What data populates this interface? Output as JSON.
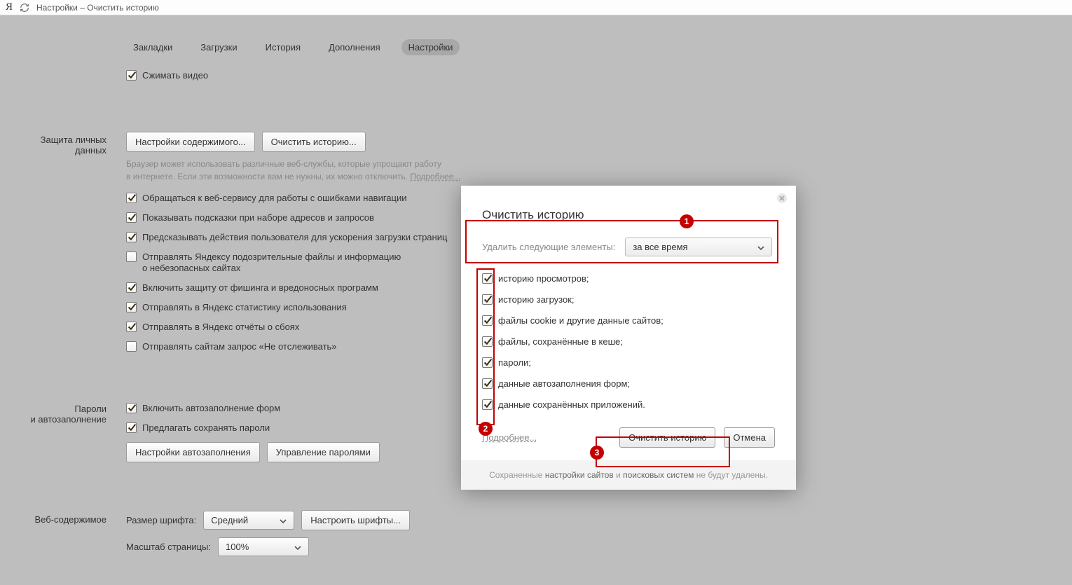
{
  "chrome": {
    "logo": "Я",
    "title": "Настройки – Очистить историю"
  },
  "tabs": {
    "bookmarks": "Закладки",
    "downloads": "Загрузки",
    "history": "История",
    "addons": "Дополнения",
    "settings": "Настройки"
  },
  "compress_video": "Сжимать видео",
  "privacy": {
    "section_title_1": "Защита личных",
    "section_title_2": "данных",
    "btn_content": "Настройки содержимого...",
    "btn_clear": "Очистить историю...",
    "desc_1": "Браузер может использовать различные веб-службы, которые упрощают работу",
    "desc_2": "в интернете. Если эти возможности вам не нужны, их можно отключить. ",
    "desc_more": "Подробнее...",
    "opt_nav_errors": "Обращаться к веб-сервису для работы с ошибками навигации",
    "opt_suggest": "Показывать подсказки при наборе адресов и запросов",
    "opt_predict": "Предсказывать действия пользователя для ускорения загрузки страниц",
    "opt_send_suspicious_1": "Отправлять Яндексу подозрительные файлы и информацию",
    "opt_send_suspicious_2": "о небезопасных сайтах",
    "opt_phishing": "Включить защиту от фишинга и вредоносных программ",
    "opt_stats": "Отправлять в Яндекс статистику использования",
    "opt_crash": "Отправлять в Яндекс отчёты о сбоях",
    "opt_dnt": "Отправлять сайтам запрос «Не отслеживать»"
  },
  "passwords": {
    "section_title_1": "Пароли",
    "section_title_2": "и автозаполнение",
    "opt_autofill": "Включить автозаполнение форм",
    "opt_save_pw": "Предлагать сохранять пароли",
    "btn_autofill": "Настройки автозаполнения",
    "btn_manage_pw": "Управление паролями"
  },
  "webcontent": {
    "section_title": "Веб-содержимое",
    "font_size_label": "Размер шрифта:",
    "font_size_value": "Средний",
    "btn_fonts": "Настроить шрифты...",
    "zoom_label": "Масштаб страницы:",
    "zoom_value": "100%"
  },
  "modal": {
    "title": "Очистить историю",
    "delete_label": "Удалить следующие элементы:",
    "period_value": "за все время",
    "items": {
      "browsing": "историю просмотров;",
      "downloads": "историю загрузок;",
      "cookies": "файлы cookie и другие данные сайтов;",
      "cache": "файлы, сохранённые в кеше;",
      "passwords": "пароли;",
      "autofill": "данные автозаполнения форм;",
      "apps": "данные сохранённых приложений."
    },
    "more": "Подробнее...",
    "btn_clear": "Очистить историю",
    "btn_cancel": "Отмена",
    "note_1": "Сохраненные ",
    "note_2": "настройки сайтов",
    "note_3": " и ",
    "note_4": "поисковых систем",
    "note_5": " не будут удалены."
  },
  "annotations": {
    "a1": "1",
    "a2": "2",
    "a3": "3"
  }
}
